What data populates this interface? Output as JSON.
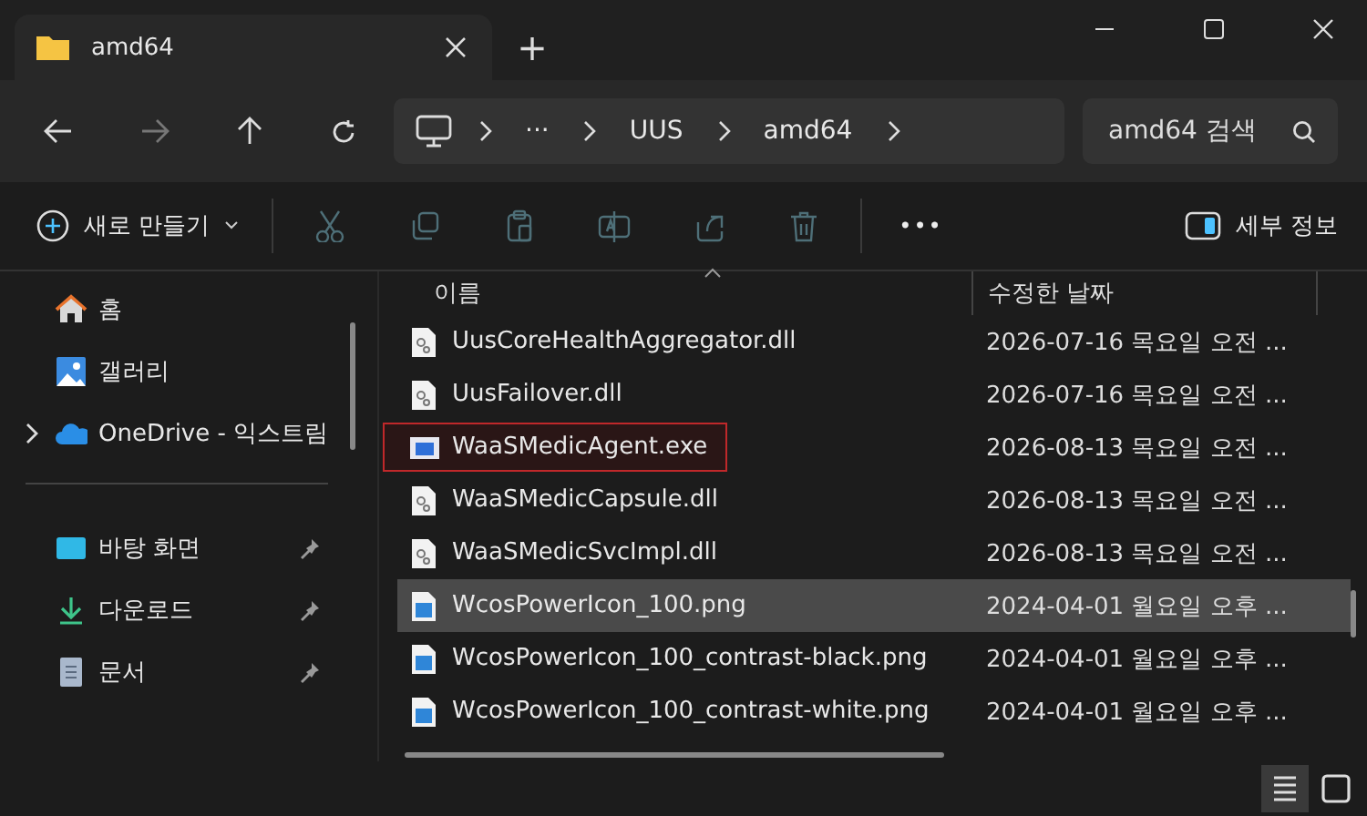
{
  "window": {
    "tab_title": "amd64",
    "new_tab": "+"
  },
  "address": {
    "crumbs": [
      "···",
      "UUS",
      "amd64"
    ],
    "search": {
      "placeholder": "amd64 검색"
    }
  },
  "toolbar": {
    "new_button": "새로 만들기",
    "actions": [
      {
        "kind": "cut",
        "disabled": true
      },
      {
        "kind": "copy",
        "disabled": true
      },
      {
        "kind": "paste",
        "disabled": true
      },
      {
        "kind": "rename",
        "disabled": true
      },
      {
        "kind": "share",
        "disabled": true
      },
      {
        "kind": "delete",
        "disabled": true
      }
    ],
    "more": "•••",
    "details_button": "세부 정보"
  },
  "sidebar": {
    "items": [
      {
        "label": "홈",
        "kind": "home",
        "pinned": false,
        "expandable": false
      },
      {
        "label": "갤러리",
        "kind": "gallery",
        "pinned": false,
        "expandable": false
      },
      {
        "label": "OneDrive - 익스트림",
        "kind": "cloud",
        "pinned": false,
        "expandable": true
      },
      {
        "label": "바탕 화면",
        "kind": "desktop",
        "pinned": true,
        "expandable": false
      },
      {
        "label": "다운로드",
        "kind": "download",
        "pinned": true,
        "expandable": false
      },
      {
        "label": "문서",
        "kind": "document",
        "pinned": true,
        "expandable": false
      }
    ]
  },
  "table": {
    "columns": [
      "이름",
      "수정한 날짜"
    ],
    "rows": [
      {
        "name": "UusCoreHealthAggregator.dll",
        "date": "2026-07-16 목요일 오전 ...",
        "kind": "dll",
        "selected": false,
        "highlighted": false
      },
      {
        "name": "UusFailover.dll",
        "date": "2026-07-16 목요일 오전 ...",
        "kind": "dll",
        "selected": false,
        "highlighted": false
      },
      {
        "name": "WaaSMedicAgent.exe",
        "date": "2026-08-13 목요일 오전 ...",
        "kind": "exe",
        "selected": false,
        "highlighted": true
      },
      {
        "name": "WaaSMedicCapsule.dll",
        "date": "2026-08-13 목요일 오전 ...",
        "kind": "dll",
        "selected": false,
        "highlighted": false
      },
      {
        "name": "WaaSMedicSvcImpl.dll",
        "date": "2026-08-13 목요일 오전 ...",
        "kind": "dll",
        "selected": false,
        "highlighted": false
      },
      {
        "name": "WcosPowerIcon_100.png",
        "date": "2024-04-01 월요일 오후 ...",
        "kind": "png",
        "selected": true,
        "highlighted": false
      },
      {
        "name": "WcosPowerIcon_100_contrast-black.png",
        "date": "2024-04-01 월요일 오후 ...",
        "kind": "png",
        "selected": false,
        "highlighted": false
      },
      {
        "name": "WcosPowerIcon_100_contrast-white.png",
        "date": "2024-04-01 월요일 오후 ...",
        "kind": "png",
        "selected": false,
        "highlighted": false
      }
    ]
  },
  "view_buttons": [
    {
      "kind": "details",
      "selected": true
    },
    {
      "kind": "tiles",
      "selected": false
    }
  ]
}
